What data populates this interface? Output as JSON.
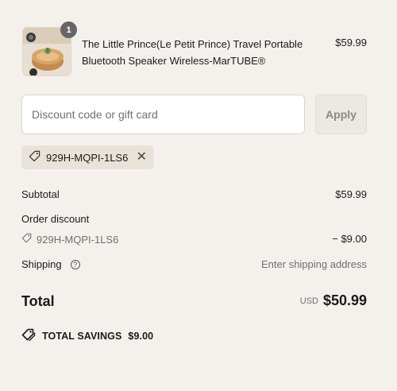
{
  "product": {
    "name": "The Little Prince(Le Petit Prince) Travel Portable Bluetooth Speaker Wireless-MarTUBE®",
    "price": "$59.99",
    "quantity": "1",
    "image_icon": "product-thumbnail"
  },
  "discount": {
    "placeholder": "Discount code or gift card",
    "apply_label": "Apply",
    "applied_code": "929H-MQPI-1LS6"
  },
  "summary": {
    "subtotal_label": "Subtotal",
    "subtotal_value": "$59.99",
    "order_discount_label": "Order discount",
    "discount_code": "929H-MQPI-1LS6",
    "discount_value": "− $9.00",
    "shipping_label": "Shipping",
    "shipping_value": "Enter shipping address",
    "total_label": "Total",
    "currency": "USD",
    "total_value": "$50.99",
    "savings_label": "TOTAL SAVINGS",
    "savings_value": "$9.00"
  },
  "colors": {
    "background": "#f4f1ec",
    "chip": "#e8e2d9",
    "badge": "#666666"
  }
}
